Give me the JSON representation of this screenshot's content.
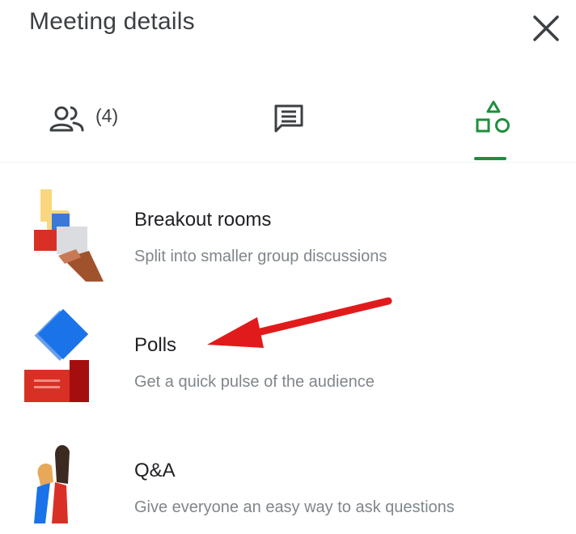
{
  "header": {
    "title": "Meeting details"
  },
  "tabs": {
    "people_count": "(4)"
  },
  "items": [
    {
      "title": "Breakout rooms",
      "description": "Split into smaller group discussions"
    },
    {
      "title": "Polls",
      "description": "Get a quick pulse of the audience"
    },
    {
      "title": "Q&A",
      "description": "Give everyone an easy way to ask questions"
    }
  ],
  "colors": {
    "accent": "#1e8e3e",
    "annotation": "#e11b1b"
  },
  "icons": [
    "close-icon",
    "people-icon",
    "chat-icon",
    "activities-icon"
  ]
}
